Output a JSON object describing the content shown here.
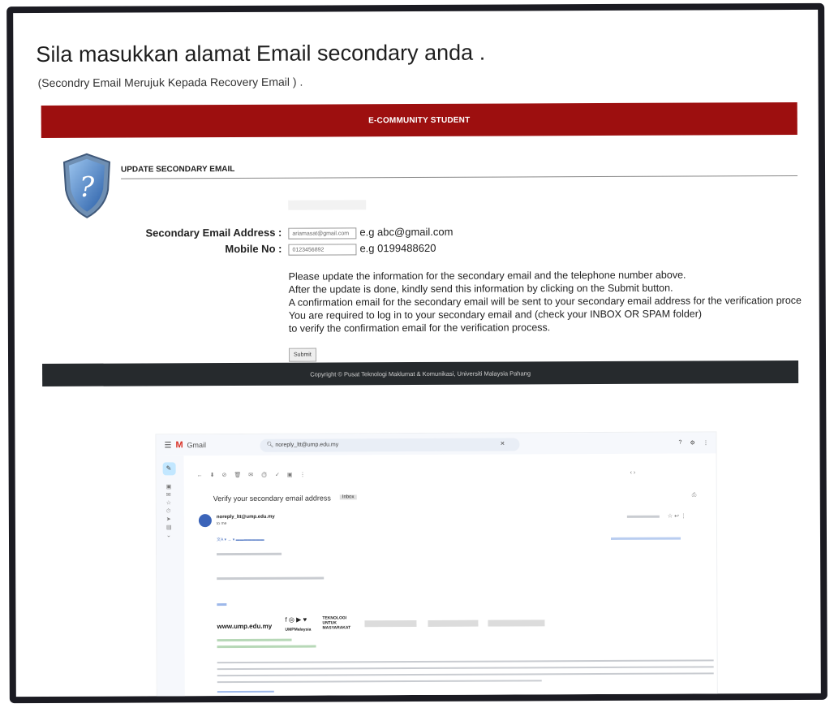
{
  "page": {
    "title": "Sila masukkan alamat Email secondary anda .",
    "subtitle": "(Secondry Email Merujuk Kepada Recovery Email ) ."
  },
  "portal": {
    "banner": "E-COMMUNITY STUDENT",
    "section_title": "UPDATE SECONDARY EMAIL",
    "form": {
      "secondary_email_label": "Secondary Email Address :",
      "secondary_email_value": "ariamasat@gmail.com",
      "secondary_email_hint": "e.g abc@gmail.com",
      "mobile_label": "Mobile No :",
      "mobile_value": "0123456892",
      "mobile_hint": "e.g 0199488620"
    },
    "info_lines": [
      "Please update the information for the secondary email and the telephone number above.",
      "After the update is done, kindly send this information by clicking on the Submit button.",
      "A confirmation email for the secondary email will be sent to your secondary email address for the verification proce",
      "You are required to log in to your secondary email and (check your INBOX OR SPAM folder)",
      "to verify the confirmation email for the verification process."
    ],
    "submit_label": "Submit",
    "footer": "Copyright © Pusat Teknologi Maklumat & Komunikasi, Universiti Malaysia Pahang"
  },
  "gmail": {
    "app_name": "Gmail",
    "search_value": "noreply_ltt@ump.edu.my",
    "subject": "Verify your secondary email address",
    "label_tag": "Inbox",
    "sender": "noreply_ltt@ump.edu.my",
    "to_me": "to me",
    "website": "www.ump.edu.my",
    "social_handle": "UMPMalaysia",
    "tagline": "TEKNOLOGI UNTUK MASYARAKAT",
    "colors": {
      "banner": "#9d0f0f",
      "footer": "#262a2d",
      "gmail_bg": "#f6f8fc",
      "link": "#1a73e8"
    }
  }
}
